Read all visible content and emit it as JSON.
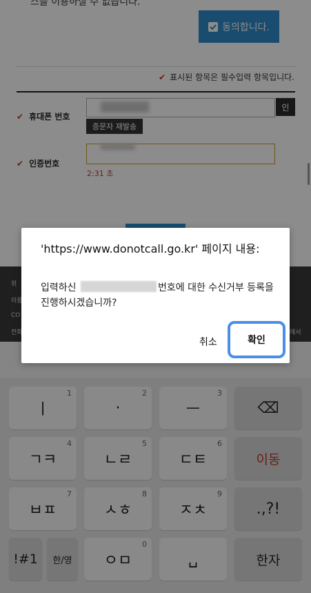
{
  "page": {
    "consent_text": "스를 이용하실 수 없습니다.",
    "agree_label": "동의합니다.",
    "required_notice": "표시된 항목은 필수입력 항목입니다.",
    "phone_label": "휴대폰 번호",
    "phone_side_button": "인",
    "resend_label": "증문자 재발송",
    "code_label": "인증번호",
    "timer": "2:31 초",
    "footer_lines": [
      "위",
      "이용",
      "CO",
      "전화"
    ],
    "footer_right": "에서"
  },
  "dialog": {
    "title": "'https://www.donotcall.go.kr' 페이지 내용:",
    "message_prefix": "입력하신 ",
    "message_suffix": "번호에 대한 수신거부 등록을 진행하시겠습니까?",
    "cancel_label": "취소",
    "ok_label": "확인"
  },
  "keyboard": {
    "rows": [
      [
        {
          "label": "ㅣ",
          "hint": "1"
        },
        {
          "label": "·",
          "hint": "2"
        },
        {
          "label": "ㅡ",
          "hint": "3"
        },
        {
          "label": "⌫",
          "hint": ""
        }
      ],
      [
        {
          "label": "ㄱㅋ",
          "hint": "4"
        },
        {
          "label": "ㄴㄹ",
          "hint": "5"
        },
        {
          "label": "ㄷㅌ",
          "hint": "6"
        },
        {
          "label": "이동",
          "hint": ""
        }
      ],
      [
        {
          "label": "ㅂㅍ",
          "hint": "7"
        },
        {
          "label": "ㅅㅎ",
          "hint": "8"
        },
        {
          "label": "ㅈㅊ",
          "hint": "9"
        },
        {
          "label": ".,?!",
          "hint": ""
        }
      ],
      [
        {
          "label": "!#1",
          "hint": ""
        },
        {
          "label": "한/영",
          "hint": ""
        },
        {
          "label": "ㅇㅁ",
          "hint": "0"
        },
        {
          "label": "␣",
          "hint": ""
        },
        {
          "label": "한자",
          "hint": ""
        }
      ]
    ]
  },
  "colors": {
    "accent": "#2e8bc9",
    "highlight": "#4a8ee8",
    "required": "#c0392b"
  }
}
